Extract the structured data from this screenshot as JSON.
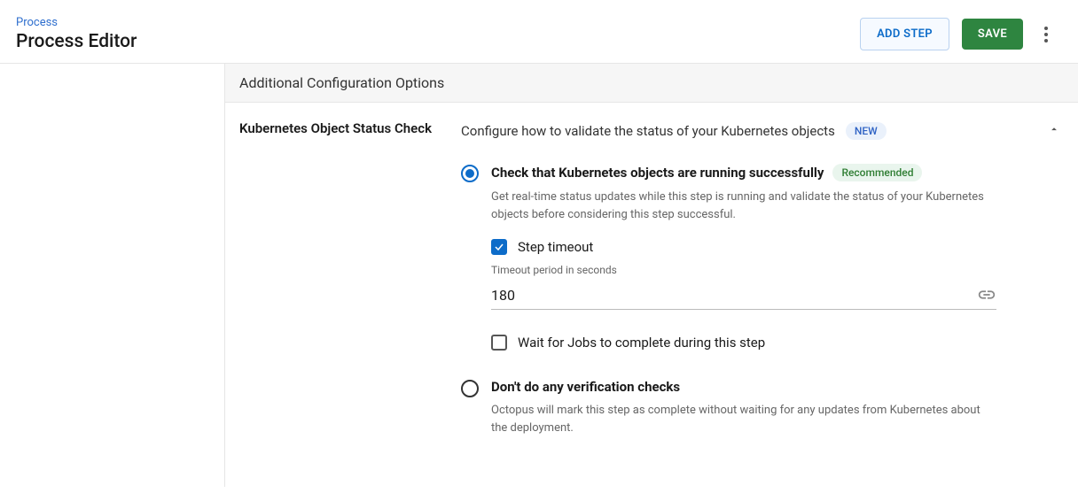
{
  "breadcrumb": "Process",
  "page_title": "Process Editor",
  "header": {
    "add_step": "ADD STEP",
    "save": "SAVE"
  },
  "section": {
    "title": "Additional Configuration Options",
    "item": {
      "label": "Kubernetes Object Status Check",
      "description": "Configure how to validate the status of your Kubernetes objects",
      "badge_new": "NEW"
    }
  },
  "options": {
    "check_running": {
      "title": "Check that Kubernetes objects are running successfully",
      "badge": "Recommended",
      "help": "Get real-time status updates while this step is running and validate the status of your Kubernetes objects before considering this step successful.",
      "step_timeout_label": "Step timeout",
      "timeout_hint": "Timeout period in seconds",
      "timeout_value": "180",
      "wait_jobs_label": "Wait for Jobs to complete during this step"
    },
    "no_verify": {
      "title": "Don't do any verification checks",
      "help": "Octopus will mark this step as complete without waiting for any updates from Kubernetes about the deployment."
    }
  }
}
